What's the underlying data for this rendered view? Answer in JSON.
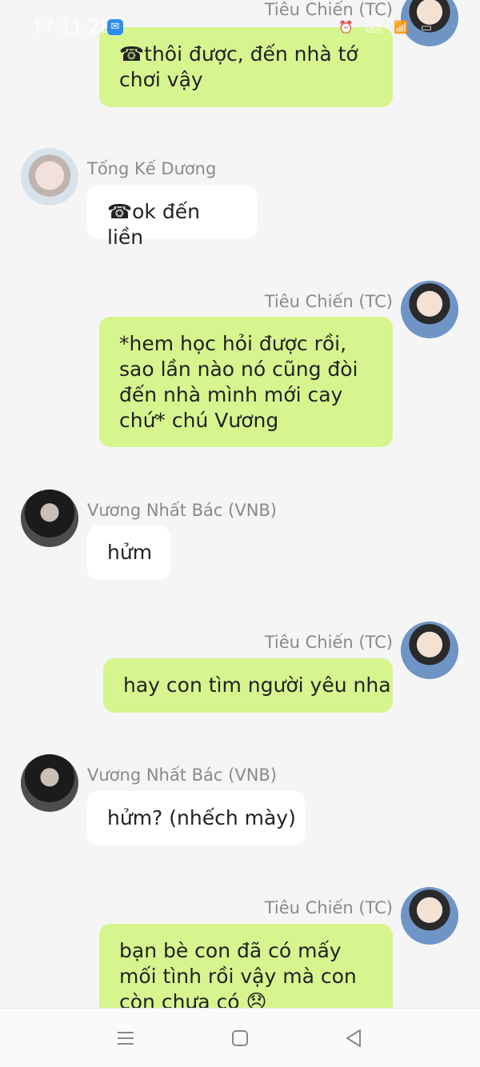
{
  "status_bar": {
    "time": "17:11:28",
    "net_speed": "1.00\nKB/S"
  },
  "messages": [
    {
      "side": "right",
      "sender": "Tiêu Chiến (TC)",
      "text": "☎thôi được, đến nhà tớ chơi vậy",
      "avatar": "tieu-chien-avatar"
    },
    {
      "side": "left",
      "sender": "Tống Kế Dương",
      "text": "☎ok đến liền",
      "avatar": "tong-ke-duong-avatar"
    },
    {
      "side": "right",
      "sender": "Tiêu Chiến (TC)",
      "text": "*hem học hỏi được rồi, sao lần nào nó cũng đòi đến nhà mình mới cay chứ* chú Vương",
      "avatar": "tieu-chien-avatar"
    },
    {
      "side": "left",
      "sender": "Vương Nhất Bác (VNB)",
      "text": "hửm",
      "avatar": "vuong-nhat-bac-avatar"
    },
    {
      "side": "right",
      "sender": "Tiêu Chiến (TC)",
      "text": "hay con tìm người yêu nha",
      "avatar": "tieu-chien-avatar"
    },
    {
      "side": "left",
      "sender": "Vương Nhất Bác (VNB)",
      "text": "hửm? (nhếch mày)",
      "avatar": "vuong-nhat-bac-avatar"
    },
    {
      "side": "right",
      "sender": "Tiêu Chiến (TC)",
      "text": "bạn bè con đã có mấy mối tình rồi vậy mà con còn chưa có 😞",
      "avatar": "tieu-chien-avatar"
    }
  ],
  "colors": {
    "bubble_self": "#d6f58f",
    "bubble_other": "#ffffff",
    "background": "#f5f5f5",
    "sender_text": "#8a8a8a"
  },
  "navbar": {
    "icons": [
      "menu-icon",
      "home-square-icon",
      "back-triangle-icon"
    ]
  }
}
